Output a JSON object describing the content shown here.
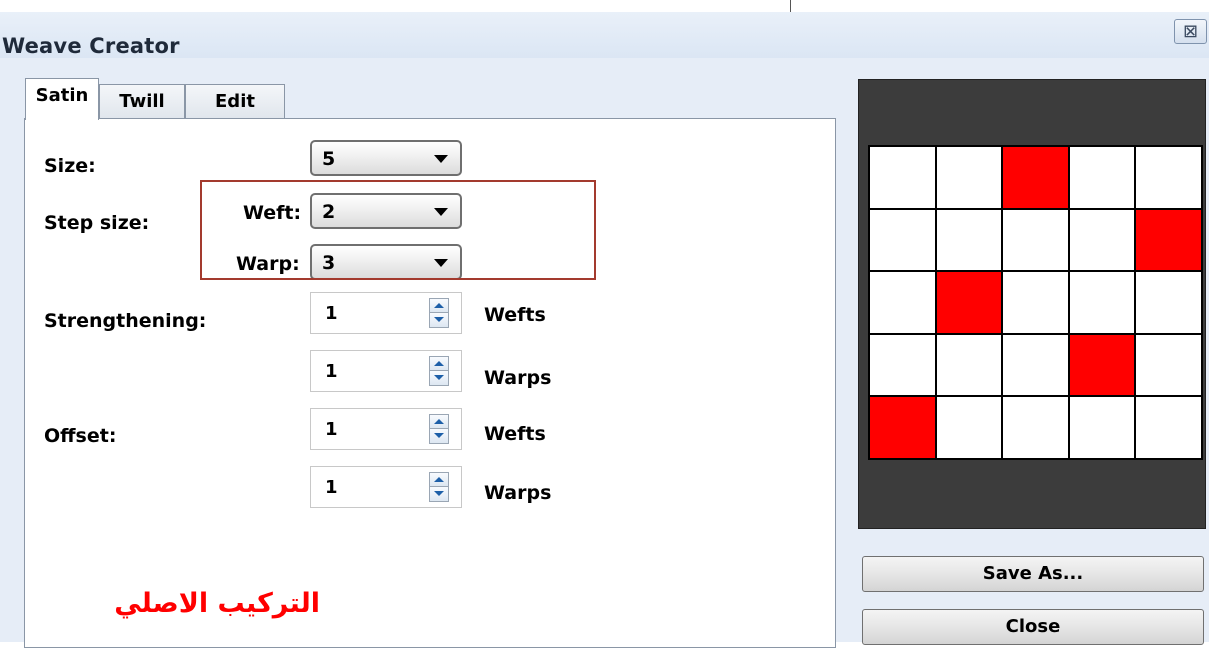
{
  "window": {
    "title": "Weave Creator",
    "close_glyph": "⊠"
  },
  "tabs": [
    {
      "label": "Satin",
      "active": true
    },
    {
      "label": "Twill",
      "active": false
    },
    {
      "label": "Edit",
      "active": false
    }
  ],
  "form": {
    "size_label": "Size:",
    "size_value": "5",
    "step_label": "Step size:",
    "weft_label": "Weft:",
    "weft_value": "2",
    "warp_label": "Warp:",
    "warp_value": "3",
    "strength_label": "Strengthening:",
    "strength_wefts_value": "1",
    "strength_wefts_unit": "Wefts",
    "strength_warps_value": "1",
    "strength_warps_unit": "Warps",
    "offset_label": "Offset:",
    "offset_wefts_value": "1",
    "offset_wefts_unit": "Wefts",
    "offset_warps_value": "1",
    "offset_warps_unit": "Warps"
  },
  "annotation": {
    "text": "التركيب الاصلي",
    "color": "#ff0000"
  },
  "preview": {
    "rows": 5,
    "cols": 5,
    "filled_cells": [
      [
        0,
        2
      ],
      [
        1,
        4
      ],
      [
        2,
        1
      ],
      [
        3,
        3
      ],
      [
        4,
        0
      ]
    ],
    "fill_color": "#ff0000",
    "background_color": "#3c3c3c"
  },
  "buttons": {
    "save_as": "Save As...",
    "close": "Close"
  }
}
